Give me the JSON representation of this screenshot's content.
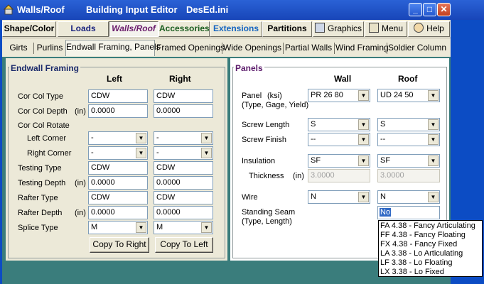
{
  "window": {
    "app_title": "Walls/Roof",
    "subtitle": "Building Input Editor",
    "file": "DesEd.ini"
  },
  "toolbar": {
    "shape_color": "Shape/Color",
    "loads": "Loads",
    "walls_roof": "Walls/Roof",
    "accessories": "Accessories",
    "extensions": "Extensions",
    "partitions": "Partitions",
    "graphics": "Graphics",
    "menu": "Menu",
    "help": "Help"
  },
  "tabs": [
    "Girts",
    "Purlins",
    "Endwall Framing, Panels",
    "Framed Openings",
    "Wide Openings",
    "Partial Walls",
    "Wind Framing",
    "Soldier Column"
  ],
  "endwall": {
    "title": "Endwall Framing",
    "col_left": "Left",
    "col_right": "Right",
    "cor_col_type_label": "Cor Col Type",
    "cor_col_type_left": "CDW",
    "cor_col_type_right": "CDW",
    "cor_col_depth_label": "Cor Col Depth",
    "cor_col_depth_unit": "(in)",
    "cor_col_depth_left": "0.0000",
    "cor_col_depth_right": "0.0000",
    "cor_col_rotate_label": "Cor Col Rotate",
    "left_corner_label": "Left Corner",
    "left_corner_left": "-",
    "left_corner_right": "-",
    "right_corner_label": "Right Corner",
    "right_corner_left": "-",
    "right_corner_right": "-",
    "testing_type_label": "Testing Type",
    "testing_type_left": "CDW",
    "testing_type_right": "CDW",
    "testing_depth_label": "Testing Depth",
    "testing_depth_unit": "(in)",
    "testing_depth_left": "0.0000",
    "testing_depth_right": "0.0000",
    "rafter_type_label": "Rafter Type",
    "rafter_type_left": "CDW",
    "rafter_type_right": "CDW",
    "rafter_depth_label": "Rafter Depth",
    "rafter_depth_unit": "(in)",
    "rafter_depth_left": "0.0000",
    "rafter_depth_right": "0.0000",
    "splice_type_label": "Splice Type",
    "splice_type_left": "M",
    "splice_type_right": "M",
    "copy_to_right": "Copy To Right",
    "copy_to_left": "Copy To Left"
  },
  "panels": {
    "title": "Panels",
    "col_wall": "Wall",
    "col_roof": "Roof",
    "panel_label": "Panel",
    "panel_unit": "(ksi)",
    "panel_sublabel": "(Type, Gage, Yield)",
    "panel_wall": "PR 26 80",
    "panel_roof": "UD 24 50",
    "screw_length_label": "Screw Length",
    "screw_length_wall": "S",
    "screw_length_roof": "S",
    "screw_finish_label": "Screw Finish",
    "screw_finish_wall": "--",
    "screw_finish_roof": "--",
    "insulation_label": "Insulation",
    "insulation_wall": "SF",
    "insulation_roof": "SF",
    "thickness_label": "Thickness",
    "thickness_unit": "(in)",
    "thickness_wall": "3.0000",
    "thickness_roof": "3.0000",
    "wire_label": "Wire",
    "wire_wall": "N",
    "wire_roof": "N",
    "standing_seam_label": "Standing Seam",
    "standing_seam_sublabel": "(Type, Length)",
    "standing_seam_value": "No",
    "standing_seam_options": [
      "FA 4.38 - Fancy Articulating",
      "FF 4.38 - Fancy Floating",
      "FX 4.38 - Fancy Fixed",
      "LA 3.38 - Lo Articulating",
      "LF 3.38 - Lo Floating",
      "LX 3.38 - Lo Fixed"
    ]
  },
  "icons": {
    "app": "walls-roof-app-icon",
    "graphics": "monitor-icon",
    "menu": "book-icon",
    "help": "help-person-icon"
  },
  "colors": {
    "titlebar": "#1846b8",
    "client_bg": "#3a7d7c",
    "group_title": "#1b2a6b",
    "panels_title": "#5b1b6b",
    "loads_text": "#1a237e",
    "walls_roof_text": "#6a1b6b",
    "accessories_text": "#1b5e20",
    "extensions_text": "#1565c0",
    "selection": "#316ac5"
  }
}
